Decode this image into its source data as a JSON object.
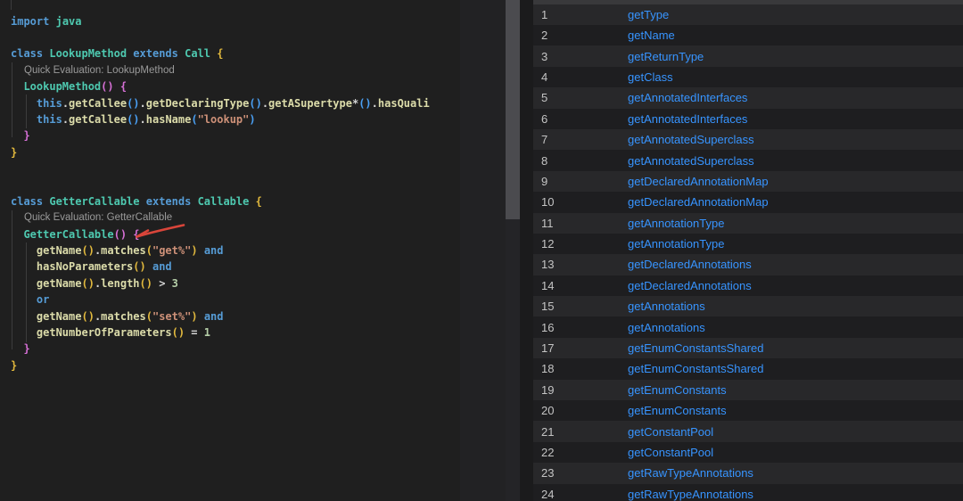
{
  "colors": {
    "editor_bg": "#1f1f1f",
    "row_number": "#c4c4c4",
    "link": "#3794ff",
    "annotation": "#d9453a",
    "token": {
      "def": "#d4d4d4",
      "kw": "#569cd6",
      "type": "#4ec9b0",
      "fn": "#dcdcaa",
      "str": "#ce9178",
      "num": "#b5cea8",
      "b1": "#e2b93d",
      "b2": "#d670d6",
      "b3": "#4aa0f5",
      "lens": "#9a9a9a"
    }
  },
  "editor": {
    "lines": [
      {
        "kind": "code",
        "tokens": [
          [
            "import",
            "kw"
          ],
          [
            " ",
            "def"
          ],
          [
            "java",
            "type"
          ]
        ]
      },
      {
        "kind": "blank"
      },
      {
        "kind": "code",
        "tokens": [
          [
            "class",
            "kw"
          ],
          [
            " ",
            "def"
          ],
          [
            "LookupMethod",
            "type"
          ],
          [
            " ",
            "def"
          ],
          [
            "extends",
            "kw"
          ],
          [
            " ",
            "def"
          ],
          [
            "Call",
            "type"
          ],
          [
            " ",
            "def"
          ],
          [
            "{",
            "b1"
          ]
        ]
      },
      {
        "kind": "lens",
        "text": "Quick Evaluation: LookupMethod"
      },
      {
        "kind": "code",
        "tokens": [
          [
            "  ",
            "def"
          ],
          [
            "LookupMethod",
            "type"
          ],
          [
            "()",
            "b2"
          ],
          [
            " ",
            "def"
          ],
          [
            "{",
            "b2"
          ]
        ]
      },
      {
        "kind": "code",
        "clip": true,
        "tokens": [
          [
            "    ",
            "def"
          ],
          [
            "this",
            "kw"
          ],
          [
            ".",
            "def"
          ],
          [
            "getCallee",
            "fn"
          ],
          [
            "()",
            "b3"
          ],
          [
            ".",
            "def"
          ],
          [
            "getDeclaringType",
            "fn"
          ],
          [
            "()",
            "b3"
          ],
          [
            ".",
            "def"
          ],
          [
            "getASupertype",
            "fn"
          ],
          [
            "*",
            "def"
          ],
          [
            "()",
            "b3"
          ],
          [
            ".",
            "def"
          ],
          [
            "hasQualifie",
            "fn"
          ]
        ]
      },
      {
        "kind": "code",
        "tokens": [
          [
            "    ",
            "def"
          ],
          [
            "this",
            "kw"
          ],
          [
            ".",
            "def"
          ],
          [
            "getCallee",
            "fn"
          ],
          [
            "()",
            "b3"
          ],
          [
            ".",
            "def"
          ],
          [
            "hasName",
            "fn"
          ],
          [
            "(",
            "b3"
          ],
          [
            "\"lookup\"",
            "str"
          ],
          [
            ")",
            "b3"
          ]
        ]
      },
      {
        "kind": "code",
        "tokens": [
          [
            "  ",
            "def"
          ],
          [
            "}",
            "b2"
          ]
        ]
      },
      {
        "kind": "code",
        "tokens": [
          [
            "}",
            "b1"
          ]
        ]
      },
      {
        "kind": "blank"
      },
      {
        "kind": "blank"
      },
      {
        "kind": "code",
        "tokens": [
          [
            "class",
            "kw"
          ],
          [
            " ",
            "def"
          ],
          [
            "GetterCallable",
            "type"
          ],
          [
            " ",
            "def"
          ],
          [
            "extends",
            "kw"
          ],
          [
            " ",
            "def"
          ],
          [
            "Callable",
            "type"
          ],
          [
            " ",
            "def"
          ],
          [
            "{",
            "b1"
          ]
        ]
      },
      {
        "kind": "lens",
        "text": "Quick Evaluation: GetterCallable"
      },
      {
        "kind": "code",
        "tokens": [
          [
            "  ",
            "def"
          ],
          [
            "GetterCallable",
            "type"
          ],
          [
            "()",
            "b2"
          ],
          [
            " ",
            "def"
          ],
          [
            "{",
            "b2"
          ]
        ]
      },
      {
        "kind": "code",
        "tokens": [
          [
            "    ",
            "def"
          ],
          [
            "getName",
            "fn"
          ],
          [
            "()",
            "b1"
          ],
          [
            ".",
            "def"
          ],
          [
            "matches",
            "fn"
          ],
          [
            "(",
            "b1"
          ],
          [
            "\"get%\"",
            "str"
          ],
          [
            ")",
            "b1"
          ],
          [
            " ",
            "def"
          ],
          [
            "and",
            "kw"
          ]
        ]
      },
      {
        "kind": "code",
        "tokens": [
          [
            "    ",
            "def"
          ],
          [
            "hasNoParameters",
            "fn"
          ],
          [
            "()",
            "b1"
          ],
          [
            " ",
            "def"
          ],
          [
            "and",
            "kw"
          ]
        ]
      },
      {
        "kind": "code",
        "tokens": [
          [
            "    ",
            "def"
          ],
          [
            "getName",
            "fn"
          ],
          [
            "()",
            "b1"
          ],
          [
            ".",
            "def"
          ],
          [
            "length",
            "fn"
          ],
          [
            "()",
            "b1"
          ],
          [
            " > ",
            "def"
          ],
          [
            "3",
            "num"
          ]
        ]
      },
      {
        "kind": "code",
        "tokens": [
          [
            "    ",
            "def"
          ],
          [
            "or",
            "kw"
          ]
        ]
      },
      {
        "kind": "code",
        "tokens": [
          [
            "    ",
            "def"
          ],
          [
            "getName",
            "fn"
          ],
          [
            "()",
            "b1"
          ],
          [
            ".",
            "def"
          ],
          [
            "matches",
            "fn"
          ],
          [
            "(",
            "b1"
          ],
          [
            "\"set%\"",
            "str"
          ],
          [
            ")",
            "b1"
          ],
          [
            " ",
            "def"
          ],
          [
            "and",
            "kw"
          ]
        ]
      },
      {
        "kind": "code",
        "tokens": [
          [
            "    ",
            "def"
          ],
          [
            "getNumberOfParameters",
            "fn"
          ],
          [
            "()",
            "b1"
          ],
          [
            " = ",
            "def"
          ],
          [
            "1",
            "num"
          ]
        ]
      },
      {
        "kind": "code",
        "tokens": [
          [
            "  ",
            "def"
          ],
          [
            "}",
            "b2"
          ]
        ]
      },
      {
        "kind": "code",
        "tokens": [
          [
            "}",
            "b1"
          ]
        ]
      }
    ]
  },
  "results": {
    "rows": [
      {
        "n": "1",
        "method": "getType"
      },
      {
        "n": "2",
        "method": "getName"
      },
      {
        "n": "3",
        "method": "getReturnType"
      },
      {
        "n": "4",
        "method": "getClass"
      },
      {
        "n": "5",
        "method": "getAnnotatedInterfaces"
      },
      {
        "n": "6",
        "method": "getAnnotatedInterfaces"
      },
      {
        "n": "7",
        "method": "getAnnotatedSuperclass"
      },
      {
        "n": "8",
        "method": "getAnnotatedSuperclass"
      },
      {
        "n": "9",
        "method": "getDeclaredAnnotationMap"
      },
      {
        "n": "10",
        "method": "getDeclaredAnnotationMap"
      },
      {
        "n": "11",
        "method": "getAnnotationType"
      },
      {
        "n": "12",
        "method": "getAnnotationType"
      },
      {
        "n": "13",
        "method": "getDeclaredAnnotations"
      },
      {
        "n": "14",
        "method": "getDeclaredAnnotations"
      },
      {
        "n": "15",
        "method": "getAnnotations"
      },
      {
        "n": "16",
        "method": "getAnnotations"
      },
      {
        "n": "17",
        "method": "getEnumConstantsShared"
      },
      {
        "n": "18",
        "method": "getEnumConstantsShared"
      },
      {
        "n": "19",
        "method": "getEnumConstants"
      },
      {
        "n": "20",
        "method": "getEnumConstants"
      },
      {
        "n": "21",
        "method": "getConstantPool"
      },
      {
        "n": "22",
        "method": "getConstantPool"
      },
      {
        "n": "23",
        "method": "getRawTypeAnnotations"
      },
      {
        "n": "24",
        "method": "getRawTypeAnnotations"
      }
    ]
  }
}
